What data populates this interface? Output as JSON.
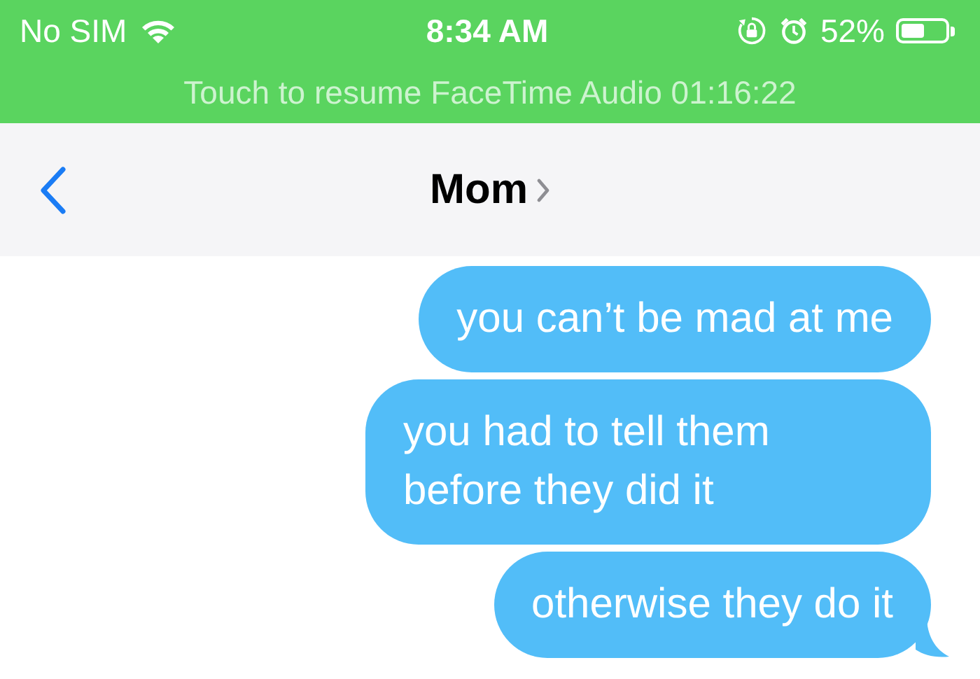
{
  "status_bar": {
    "carrier": "No SIM",
    "time": "8:34 AM",
    "battery_text": "52%"
  },
  "call_banner": {
    "text": "Touch to resume FaceTime Audio 01:16:22"
  },
  "nav": {
    "title": "Mom"
  },
  "messages": [
    {
      "text": "you can’t be mad at me",
      "sent": true,
      "tail": false
    },
    {
      "text": "you had to tell them before they did it",
      "sent": true,
      "tail": false
    },
    {
      "text": "otherwise they do it",
      "sent": true,
      "tail": true
    }
  ]
}
